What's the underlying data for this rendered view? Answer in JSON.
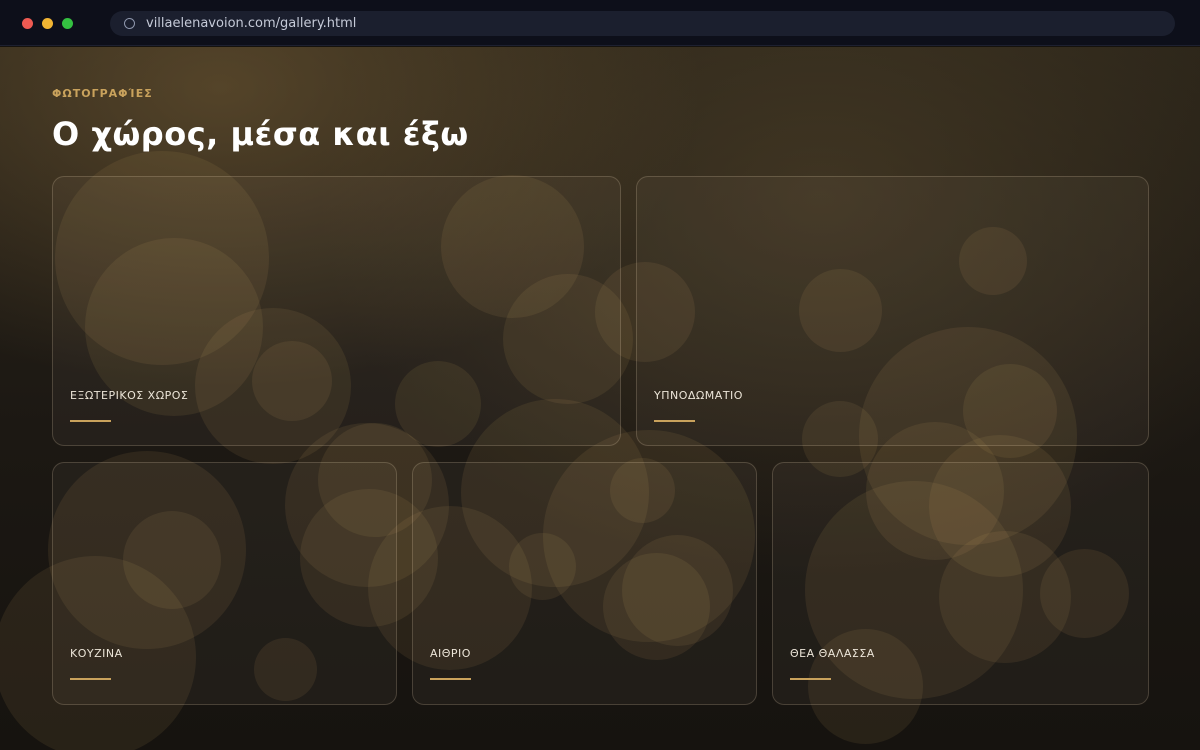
{
  "browser": {
    "url": "villaelenavoion.com/gallery.html"
  },
  "page": {
    "eyebrow": "ΦΩΤΟΓΡΑΦΊΕΣ",
    "heading": "Ο χώρος, μέσα και έξω"
  },
  "gallery": {
    "cards": [
      {
        "label": "ΕΞΩΤΕΡΙΚΟΣ ΧΩΡΟΣ"
      },
      {
        "label": "ΥΠΝΟΔΩΜΑΤΙΟ"
      },
      {
        "label": "ΚΟΥΖΙΝΑ"
      },
      {
        "label": "ΑΙΘΡΙΟ"
      },
      {
        "label": "ΘΕΑ ΘΑΛΑΣΣΑ"
      }
    ]
  },
  "colors": {
    "accent": "#c9a25c",
    "background": "#15120e",
    "chrome": "#0d0f1a"
  },
  "icons": {
    "url_bar": "circle-icon"
  }
}
